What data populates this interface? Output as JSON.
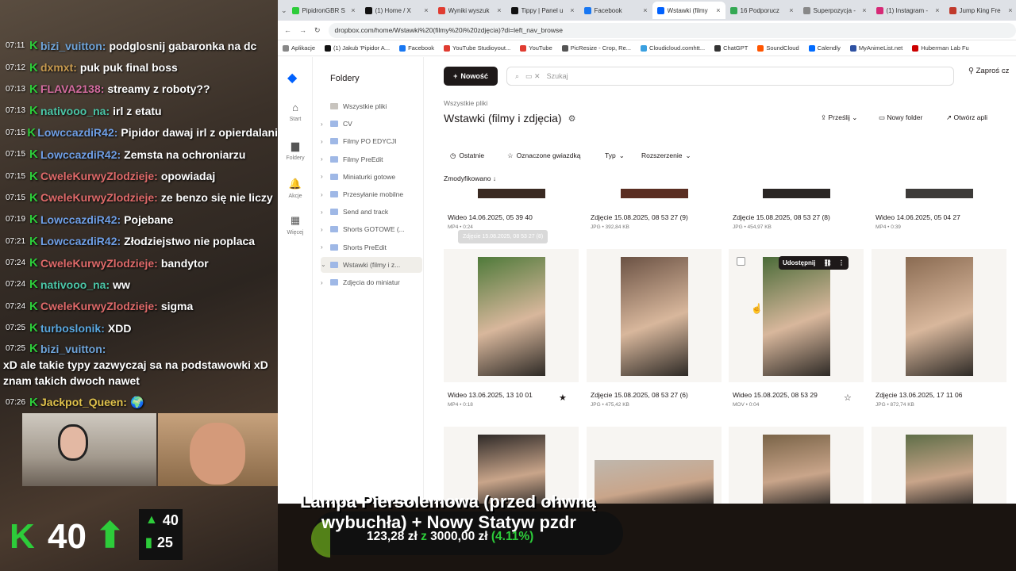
{
  "chat": [
    {
      "time": "07:11",
      "user": "bizi_vuitton:",
      "color": "#6fa4d9",
      "msg": "podglosnij gabaronka na dc"
    },
    {
      "time": "07:12",
      "user": "dxmxt:",
      "color": "#c79a4f",
      "msg": "puk puk final boss"
    },
    {
      "time": "07:13",
      "user": "FLAVA2138:",
      "color": "#d46ca0",
      "msg": "streamy z roboty??"
    },
    {
      "time": "07:13",
      "user": "nativooo_na:",
      "color": "#4bc7a8",
      "msg": "irl z etatu"
    },
    {
      "time": "07:15",
      "user": "LowccazdiR42:",
      "color": "#6f9fe6",
      "msg": "Pipidor dawaj irl z opierdalani"
    },
    {
      "time": "07:15",
      "user": "LowccazdiR42:",
      "color": "#6f9fe6",
      "msg": "Zemsta na ochroniarzu"
    },
    {
      "time": "07:15",
      "user": "CweleKurwyZlodzieje:",
      "color": "#e06a6a",
      "msg": "opowiadaj"
    },
    {
      "time": "07:15",
      "user": "CweleKurwyZlodzieje:",
      "color": "#e06a6a",
      "msg": "ze benzo się nie liczy"
    },
    {
      "time": "07:19",
      "user": "LowccazdiR42:",
      "color": "#6f9fe6",
      "msg": "Pojebane"
    },
    {
      "time": "07:21",
      "user": "LowccazdiR42:",
      "color": "#6f9fe6",
      "msg": "Złodziejstwo nie poplaca"
    },
    {
      "time": "07:24",
      "user": "CweleKurwyZlodzieje:",
      "color": "#e06a6a",
      "msg": "bandytor"
    },
    {
      "time": "07:24",
      "user": "nativooo_na:",
      "color": "#4bc7a8",
      "msg": "ww"
    },
    {
      "time": "07:24",
      "user": "CweleKurwyZlodzieje:",
      "color": "#e06a6a",
      "msg": "sigma"
    },
    {
      "time": "07:25",
      "user": "turboslonik:",
      "color": "#5aa8e0",
      "msg": "XDD"
    },
    {
      "time": "07:25",
      "user": "bizi_vuitton:",
      "color": "#6fa4d9",
      "msg": "xD ale takie typy zazwyczaj sa na podstawowki xD znam takich dwoch nawet"
    },
    {
      "time": "07:26",
      "user": "Jackpot_Queen:",
      "color": "#e0c24b",
      "msg": "🌍"
    }
  ],
  "overlay": {
    "level": "40",
    "stats": [
      "40",
      "25"
    ],
    "goal_title": "Lampa Piersolemowa (przed ohwną",
    "goal_line2": "wybuchła) + Nowy Statyw pzdr",
    "goal_current": "123,28 zł",
    "goal_z": "z",
    "goal_target": "3000,00 zł",
    "goal_pct": "(4.11%)",
    "goal_fraction": 0.0411
  },
  "tabs": [
    {
      "title": "PipidronGBR S",
      "color": "#2dcc3a"
    },
    {
      "title": "(1) Home / X",
      "color": "#111"
    },
    {
      "title": "Wyniki wyszuk",
      "color": "#e03c31"
    },
    {
      "title": "Tippy | Panel u",
      "color": "#111"
    },
    {
      "title": "Facebook",
      "color": "#1877f2"
    },
    {
      "title": "Wstawki (filmy",
      "color": "#0061fe",
      "active": true
    },
    {
      "title": "16 Podporucz",
      "color": "#34a853"
    },
    {
      "title": "Superpozycja -",
      "color": "#888"
    },
    {
      "title": "(1) Instagram -",
      "color": "#d62976"
    },
    {
      "title": "Jump King Fre",
      "color": "#c0392b"
    }
  ],
  "url": "dropbox.com/home/Wstawki%20(filmy%20i%20zdjęcia)?di=left_nav_browse",
  "bookmarks": [
    {
      "label": "Aplikacje",
      "color": "#888"
    },
    {
      "label": "(1) Jakub 'Pipidor A...",
      "color": "#111"
    },
    {
      "label": "Facebook",
      "color": "#1877f2"
    },
    {
      "label": "YouTube Studioyout...",
      "color": "#e03c31"
    },
    {
      "label": "YouTube",
      "color": "#e03c31"
    },
    {
      "label": "PicResize - Crop, Re...",
      "color": "#555"
    },
    {
      "label": "Cloudicloud.comhtt...",
      "color": "#3aa0e0"
    },
    {
      "label": "ChatGPT",
      "color": "#333"
    },
    {
      "label": "SoundCloud",
      "color": "#ff5500"
    },
    {
      "label": "Calendly",
      "color": "#006bff"
    },
    {
      "label": "MyAnimeList.net",
      "color": "#2e51a2"
    },
    {
      "label": "Huberman Lab Fu",
      "color": "#c00"
    }
  ],
  "rail": [
    {
      "label": "Start",
      "icon": "⌂"
    },
    {
      "label": "Foldery",
      "icon": "▆"
    },
    {
      "label": "Akcje",
      "icon": "🔔"
    },
    {
      "label": "Więcej",
      "icon": "▦"
    }
  ],
  "folders_title": "Foldery",
  "folders": [
    {
      "label": "Wszystkie pliki",
      "chev": ""
    },
    {
      "label": "CV",
      "chev": "›"
    },
    {
      "label": "Filmy PO EDYCJI",
      "chev": "›"
    },
    {
      "label": "Filmy PreEdit",
      "chev": "›"
    },
    {
      "label": "Miniaturki gotowe",
      "chev": "›"
    },
    {
      "label": "Przesyłanie mobilne",
      "chev": "›"
    },
    {
      "label": "Send and track",
      "chev": "›"
    },
    {
      "label": "Shorts GOTOWE (...",
      "chev": "›"
    },
    {
      "label": "Shorts PreEdit",
      "chev": "›"
    },
    {
      "label": "Wstawki (filmy i z...",
      "chev": "⌄",
      "selected": true
    },
    {
      "label": "Zdjęcia do miniatur",
      "chev": "›"
    }
  ],
  "toolbar": {
    "new": "Nowość",
    "search_placeholder": "Szukaj",
    "share": "Zaproś cz",
    "crumb": "Wszystkie pliki",
    "title": "Wstawki (filmy i zdjęcia)",
    "upload": "Prześlij",
    "new_folder": "Nowy folder",
    "open_app": "Otwórz apli",
    "filters": [
      "Ostatnie",
      "Oznaczone gwiazdką",
      "Typ",
      "Rozszerzenie"
    ],
    "sort": "Zmodyfikowano"
  },
  "files": [
    {
      "name": "Wideo 14.06.2025, 05 39 40",
      "meta": "MP4 • 0:24"
    },
    {
      "name": "Zdjęcie 15.08.2025, 08 53 27 (9)",
      "meta": "JPG • 392,84 KB"
    },
    {
      "name": "Zdjęcie 15.08.2025, 08 53 27 (8)",
      "meta": "JPG • 454,97 KB"
    },
    {
      "name": "Wideo 14.06.2025, 05 04 27",
      "meta": "MP4 • 0:39"
    },
    {
      "name": "Wideo 13.06.2025, 13 10 01",
      "meta": "MP4 • 0:18",
      "star": "★"
    },
    {
      "name": "Zdjęcie 15.08.2025, 08 53 27 (6)",
      "meta": "JPG • 475,42 KB"
    },
    {
      "name": "Wideo 15.08.2025, 08 53 29",
      "meta": "MOV • 0:04",
      "star": "☆"
    },
    {
      "name": "Zdjęcie 13.06.2025, 17 11 06",
      "meta": "JPG • 872,74 KB"
    }
  ],
  "tooltip": "Zdjęcie 15.08.2025, 08 53 27 (8)",
  "share_pop": "Udostępnij"
}
